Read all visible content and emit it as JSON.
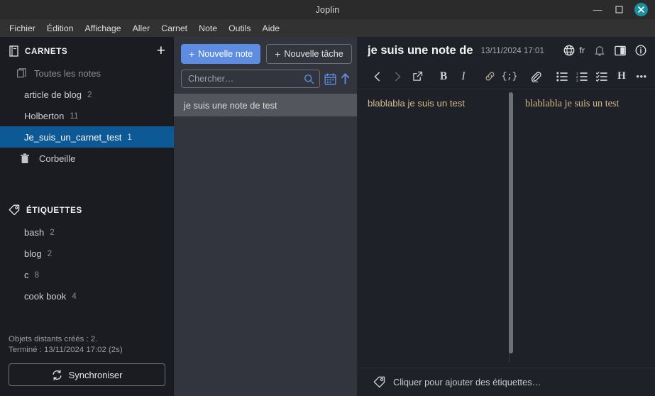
{
  "window": {
    "title": "Joplin",
    "minimize_label": "Réduire",
    "maximize_label": "Agrandir",
    "close_label": "Fermer"
  },
  "menubar": {
    "items": [
      {
        "label": "Fichier"
      },
      {
        "label": "Édition"
      },
      {
        "label": "Affichage"
      },
      {
        "label": "Aller"
      },
      {
        "label": "Carnet"
      },
      {
        "label": "Note"
      },
      {
        "label": "Outils"
      },
      {
        "label": "Aide"
      }
    ]
  },
  "sidebar": {
    "notebooks_header": {
      "label": "CARNETS",
      "icon": "notebook-icon",
      "add_label": "+"
    },
    "notebooks": [
      {
        "label": "Toutes les notes",
        "count": "",
        "icon": "all-notes-icon",
        "selected": false,
        "muted": true
      },
      {
        "label": "article de blog",
        "count": "2",
        "icon": "",
        "selected": false,
        "muted": false
      },
      {
        "label": "Holberton",
        "count": "11",
        "icon": "",
        "selected": false,
        "muted": false
      },
      {
        "label": "Je_suis_un_carnet_test",
        "count": "1",
        "icon": "",
        "selected": true,
        "muted": false
      },
      {
        "label": "Corbeille",
        "count": "",
        "icon": "trash-icon",
        "selected": false,
        "muted": false
      }
    ],
    "tags_header": {
      "label": "ÉTIQUETTES",
      "icon": "tag-icon"
    },
    "tags": [
      {
        "label": "bash",
        "count": "2"
      },
      {
        "label": "blog",
        "count": "2"
      },
      {
        "label": "c",
        "count": "8"
      },
      {
        "label": "cook book",
        "count": "4"
      }
    ],
    "sync": {
      "status_line1": "Objets distants créés : 2.",
      "status_line2": "Terminé : 13/11/2024 17:02 (2s)",
      "button_label": "Synchroniser",
      "button_icon": "sync-icon"
    }
  },
  "notelist": {
    "new_note_label": "Nouvelle note",
    "new_task_label": "Nouvelle tâche",
    "plus_glyph": "+",
    "search": {
      "placeholder": "Chercher…",
      "value": "",
      "icon": "search-icon"
    },
    "toggle_todo_icon": "calendar-icon",
    "sort_order_icon": "sort-ascending-icon",
    "notes": [
      {
        "title": "je suis une note de test",
        "selected": true
      }
    ]
  },
  "editor": {
    "note_title": "je suis une note de",
    "note_date": "13/11/2024 17:01",
    "language_code": "fr",
    "header_icons": [
      {
        "name": "globe-icon"
      },
      {
        "name": "alarm-icon"
      },
      {
        "name": "toggle-editor-layout-icon"
      },
      {
        "name": "note-properties-icon"
      }
    ],
    "toolbar": [
      {
        "name": "back-icon",
        "label": "‹",
        "disabled": false
      },
      {
        "name": "forward-icon",
        "label": "›",
        "disabled": true
      },
      {
        "name": "external-link-icon",
        "label": "",
        "disabled": false
      },
      {
        "name": "bold-icon",
        "label": "B",
        "disabled": false
      },
      {
        "name": "italic-icon",
        "label": "I",
        "disabled": false
      },
      {
        "name": "hyperlink-icon",
        "label": "",
        "disabled": false
      },
      {
        "name": "code-icon",
        "label": "{;}",
        "disabled": false
      },
      {
        "name": "attachment-icon",
        "label": "",
        "disabled": false
      },
      {
        "name": "bulleted-list-icon",
        "label": "",
        "disabled": false
      },
      {
        "name": "numbered-list-icon",
        "label": "",
        "disabled": false
      },
      {
        "name": "checkbox-list-icon",
        "label": "",
        "disabled": false
      },
      {
        "name": "heading-icon",
        "label": "H",
        "disabled": false
      },
      {
        "name": "more-options-icon",
        "label": "•••",
        "disabled": false
      },
      {
        "name": "insert-date-icon",
        "label": "",
        "disabled": false
      }
    ],
    "editor_text": "blablabla je suis un test",
    "preview_text": "blablabla je suis un test",
    "tagbar": {
      "label": "Cliquer pour ajouter des étiquettes…",
      "icon": "tag-icon"
    }
  },
  "colors": {
    "accent_blue": "#5d8ce0",
    "selection_blue": "#0d5996",
    "close_button_teal": "#1a8f9e",
    "sidebar_bg": "#1a1c22",
    "notelist_bg": "#32353d",
    "editor_bg": "#1e2127",
    "note_text": "#d4b98a"
  }
}
